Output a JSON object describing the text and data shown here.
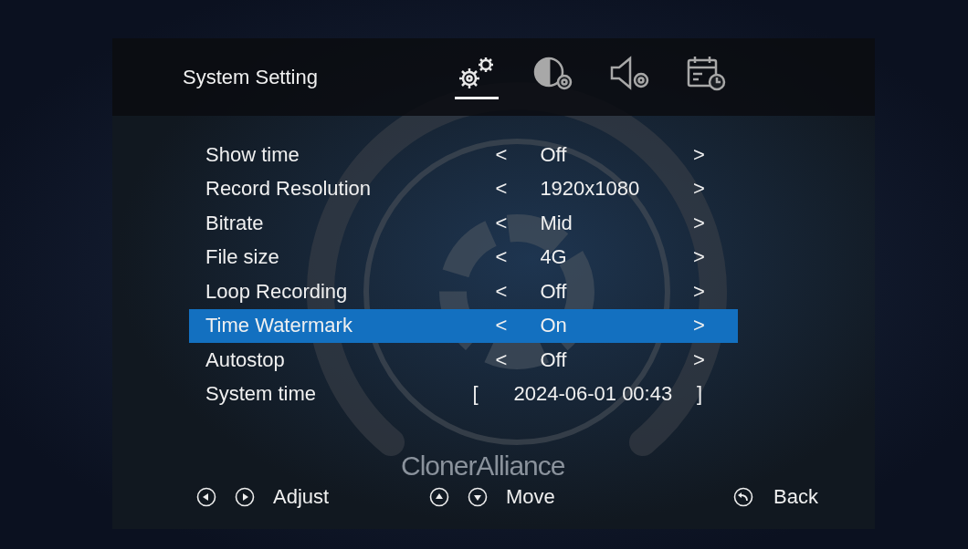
{
  "header": {
    "title": "System Setting"
  },
  "tabs": [
    {
      "kind": "system",
      "selected": true
    },
    {
      "kind": "display",
      "selected": false
    },
    {
      "kind": "audio",
      "selected": false
    },
    {
      "kind": "schedule",
      "selected": false
    }
  ],
  "background": {
    "brand_text": "ClonerAlliance"
  },
  "settings": [
    {
      "kind": "option",
      "label": "Show time",
      "prev": "<",
      "value": "Off",
      "next": ">",
      "selected": false
    },
    {
      "kind": "option",
      "label": "Record Resolution",
      "prev": "<",
      "value": "1920x1080",
      "next": ">",
      "selected": false
    },
    {
      "kind": "option",
      "label": "Bitrate",
      "prev": "<",
      "value": "Mid",
      "next": ">",
      "selected": false
    },
    {
      "kind": "option",
      "label": "File size",
      "prev": "<",
      "value": "4G",
      "next": ">",
      "selected": false
    },
    {
      "kind": "option",
      "label": "Loop Recording",
      "prev": "<",
      "value": "Off",
      "next": ">",
      "selected": false
    },
    {
      "kind": "option",
      "label": "Time Watermark",
      "prev": "<",
      "value": "On",
      "next": ">",
      "selected": true
    },
    {
      "kind": "option",
      "label": "Autostop",
      "prev": "<",
      "value": "Off",
      "next": ">",
      "selected": false
    },
    {
      "kind": "field",
      "label": "System time",
      "prev": "[",
      "value": "2024-06-01 00:43",
      "next": "]",
      "selected": false
    }
  ],
  "hints": [
    {
      "kind": "leftright",
      "label": "Adjust"
    },
    {
      "kind": "updown",
      "label": "Move"
    },
    {
      "kind": "back",
      "label": "Back"
    }
  ]
}
